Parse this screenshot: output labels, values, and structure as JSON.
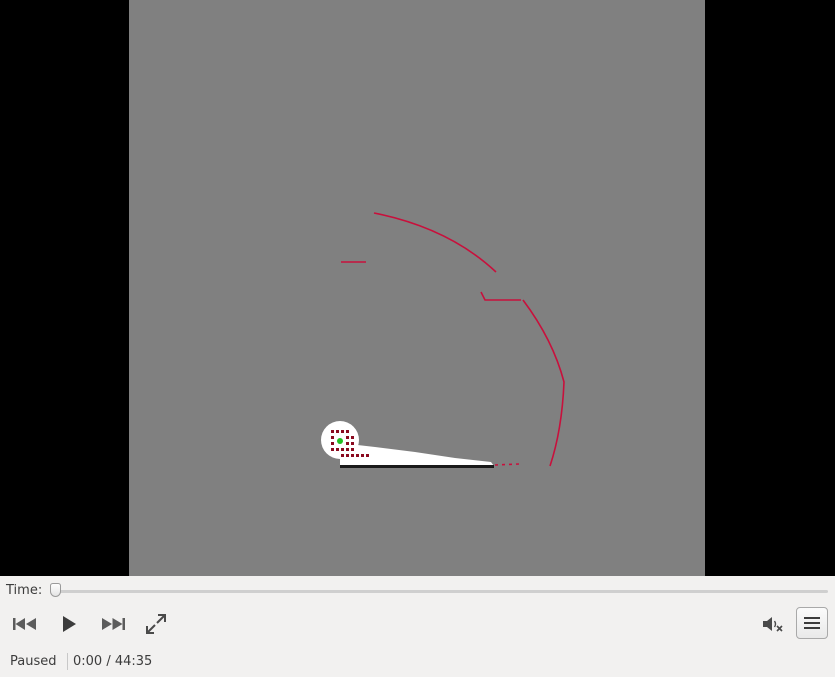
{
  "player": {
    "time_label": "Time:",
    "seek_fraction": 0,
    "status": "Paused",
    "time_readout": "0:00 / 44:35"
  },
  "icons": {
    "previous": "skip-previous-icon",
    "play": "play-icon",
    "next": "skip-next-icon",
    "fullscreen": "fullscreen-icon",
    "volume": "volume-muted-icon",
    "menu": "hamburger-menu-icon"
  },
  "colors": {
    "map_unknown": "#808080",
    "map_free": "#ffffff",
    "laser_scan": "#c8103c",
    "robot": "#22c022",
    "letterbox": "#000000",
    "toolbar_bg": "#f2f1f0"
  }
}
